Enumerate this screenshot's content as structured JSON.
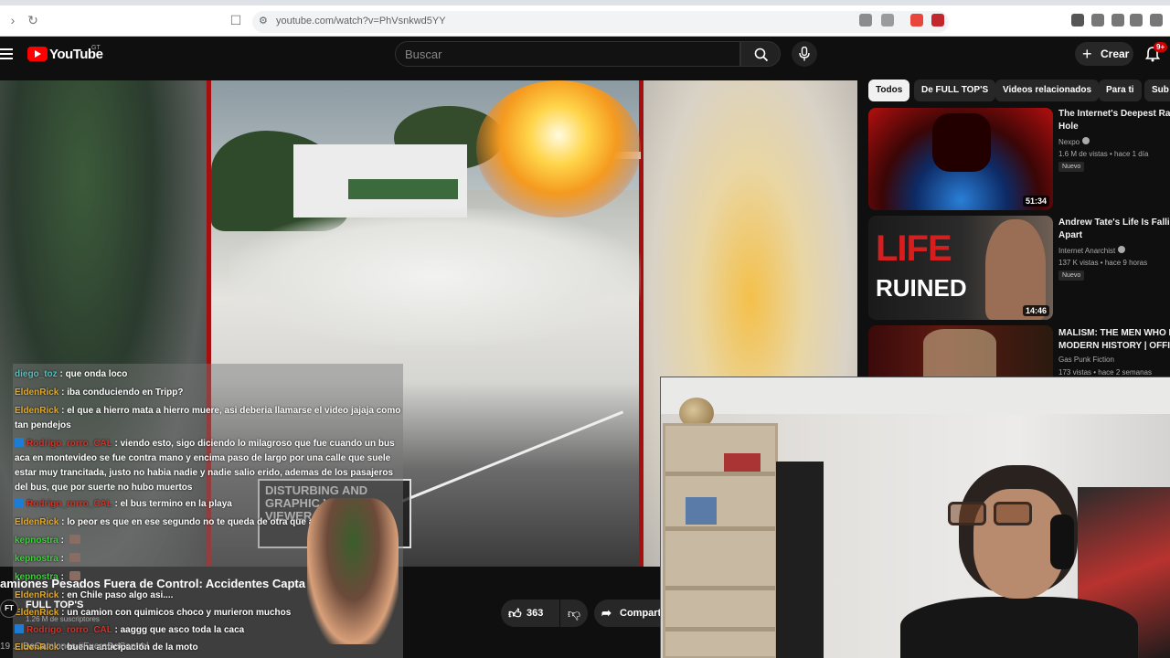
{
  "browser": {
    "url": "youtube.com/watch?v=PhVsnkwd5YY"
  },
  "header": {
    "brand": "YouTube",
    "country": "GT",
    "search_placeholder": "Buscar",
    "create_label": "Crear",
    "notifications_badge": "9+"
  },
  "video": {
    "warning_text": "DISTURBING AND\nGRAPHIC VISUALS.\nVIEWER DISCRETION"
  },
  "chat": [
    {
      "user": "diego_toz",
      "user_color": "#4fc3c3",
      "sep": " : ",
      "msg": "que onda loco",
      "twitch": false,
      "emote": false
    },
    {
      "user": "EldenRick",
      "user_color": "#e0a92c",
      "sep": " : ",
      "msg": "iba conduciendo en Tripp?",
      "twitch": false,
      "emote": false
    },
    {
      "user": "EldenRick",
      "user_color": "#e0a92c",
      "sep": " : ",
      "msg": "el que a hierro mata a hierro muere, asi deberia llamarse el video jajaja como tan pendejos",
      "twitch": false,
      "emote": false
    },
    {
      "user": "Rodrigo_rorro_CAL",
      "user_color": "#d93025",
      "sep": " : ",
      "msg": "viendo esto, sigo diciendo lo milagroso que fue cuando un bus aca en montevideo se fue contra mano y encima paso de largo por una calle que suele estar muy trancitada, justo no habia nadie y nadie salio erido, ademas de los pasajeros del bus, que por suerte no hubo muertos",
      "twitch": true,
      "emote": false
    },
    {
      "user": "Rodrigo_rorro_CAL",
      "user_color": "#d93025",
      "sep": " : ",
      "msg": "el bus termino en la playa",
      "twitch": true,
      "emote": false
    },
    {
      "user": "EldenRick",
      "user_color": "#e0a92c",
      "sep": " : ",
      "msg": "lo peor es que en ese segundo no te queda de otra que aceptarlo",
      "twitch": false,
      "emote": false
    },
    {
      "user": "kepnostra",
      "user_color": "#3ad13a",
      "sep": " : ",
      "msg": "",
      "twitch": false,
      "emote": true
    },
    {
      "user": "kepnostra",
      "user_color": "#3ad13a",
      "sep": " : ",
      "msg": "",
      "twitch": false,
      "emote": true
    },
    {
      "user": "kepnostra",
      "user_color": "#3ad13a",
      "sep": " : ",
      "msg": "",
      "twitch": false,
      "emote": true
    },
    {
      "user": "EldenRick",
      "user_color": "#e0a92c",
      "sep": " : ",
      "msg": "en Chile paso algo asi....",
      "twitch": false,
      "emote": false
    },
    {
      "user": "EldenRick",
      "user_color": "#e0a92c",
      "sep": " : ",
      "msg": "un camion con quimicos choco y murieron muchos",
      "twitch": false,
      "emote": false
    },
    {
      "user": "Rodrigo_rorro_CAL",
      "user_color": "#d93025",
      "sep": " : ",
      "msg": "aaggg que asco toda la caca",
      "twitch": true,
      "emote": false
    },
    {
      "user": "EldenRick",
      "user_color": "#e0a92c",
      "sep": " : ",
      "msg": "buena anticipación de la moto",
      "twitch": false,
      "emote": false
    }
  ],
  "below_video": {
    "title": "amiones Pesados Fuera de Control: Accidentes Capta",
    "channel_avatar": "FT",
    "channel_name": "FULL TOP'S",
    "subscribers": "1.26 M de suscriptores",
    "hashtags": "19 ... DeCamiones #FueraDeControl",
    "likes": "363",
    "share_label": "Compartir"
  },
  "chips": [
    "Todos",
    "De FULL TOP'S",
    "Videos relacionados",
    "Para ti",
    "Sub"
  ],
  "recommendations": [
    {
      "title1": "The Internet's Deepest Rabb",
      "title2": "Hole",
      "channel": "Nexpo",
      "verified": true,
      "views": "1.6 M de vistas • hace 1 día",
      "badge": "Nuevo",
      "duration": "51:34"
    },
    {
      "title1": "Andrew Tate's Life Is Falling",
      "title2": "Apart",
      "channel": "Internet Anarchist",
      "verified": true,
      "views": "137 K vistas • hace 9 horas",
      "badge": "Nuevo",
      "duration": "14:46",
      "thumb_text1": "LIFE",
      "thumb_text2": "RUINED"
    },
    {
      "title1": "MALISM: THE MEN WHO BU",
      "title2": "MODERN HISTORY | OFFICI",
      "channel": "Gas Punk Fiction",
      "verified": false,
      "views": "173 vistas • hace 2 semanas",
      "badge": "",
      "duration": ""
    }
  ],
  "colors": {
    "accent_red": "#ff0000",
    "background": "#0f0f0f"
  }
}
